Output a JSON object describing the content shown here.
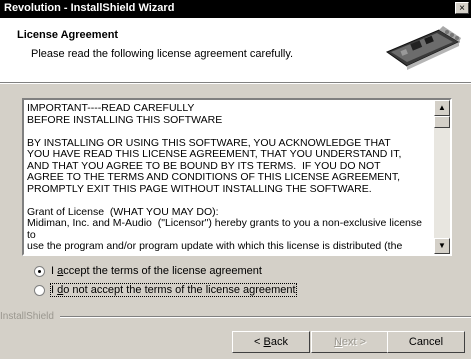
{
  "window": {
    "title": "Revolution - InstallShield Wizard",
    "close_glyph": "×"
  },
  "header": {
    "title": "License Agreement",
    "subtitle": "Please read the following license agreement carefully.",
    "art_icon": "sound-card-icon"
  },
  "license": {
    "text": "IMPORTANT----READ CAREFULLY\nBEFORE INSTALLING THIS SOFTWARE\n\nBY INSTALLING OR USING THIS SOFTWARE, YOU ACKNOWLEDGE THAT\nYOU HAVE READ THIS LICENSE AGREEMENT, THAT YOU UNDERSTAND IT,\nAND THAT YOU AGREE TO BE BOUND BY ITS TERMS.  IF YOU DO NOT\nAGREE TO THE TERMS AND CONDITIONS OF THIS LICENSE AGREEMENT,\nPROMPTLY EXIT THIS PAGE WITHOUT INSTALLING THE SOFTWARE.\n\nGrant of License  (WHAT YOU MAY DO):\nMidiman, Inc. and M-Audio  (\"Licensor\") hereby grants to you a non-exclusive license to\nuse the program and/or program update with which this license is distributed (the",
    "scroll_up": "▲",
    "scroll_down": "▼"
  },
  "options": {
    "accept": {
      "prefix": "I ",
      "accel": "a",
      "rest": "ccept the terms of the license agreement",
      "checked": true
    },
    "decline": {
      "prefix": "I ",
      "accel": "d",
      "rest": "o not accept the terms of the license agreement",
      "checked": false
    }
  },
  "footer": {
    "brand": "InstallShield"
  },
  "buttons": {
    "back": {
      "prefix": "< ",
      "accel": "B",
      "rest": "ack"
    },
    "next": {
      "prefix": "",
      "accel": "N",
      "rest": "ext >"
    },
    "cancel": "Cancel"
  }
}
